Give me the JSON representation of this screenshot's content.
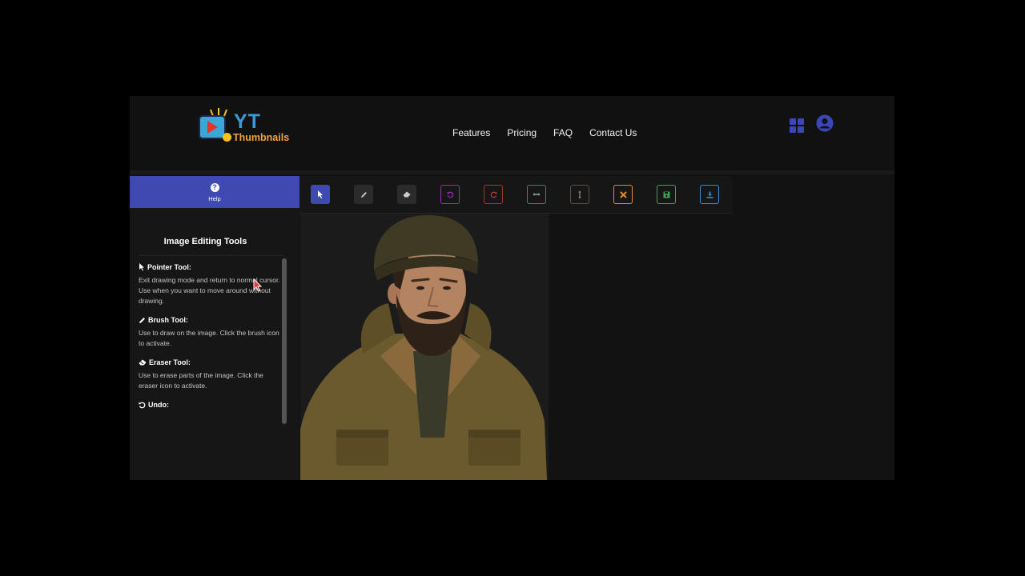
{
  "brand": {
    "logo_top": "YT",
    "logo_bottom": "Thumbnails"
  },
  "nav": [
    {
      "label": "Features"
    },
    {
      "label": "Pricing"
    },
    {
      "label": "FAQ"
    },
    {
      "label": "Contact Us"
    }
  ],
  "header_icons": [
    "grid-icon",
    "user-circle-icon"
  ],
  "help": {
    "icon": "question-circle-icon",
    "label": "Help"
  },
  "sidebar": {
    "title": "Image Editing Tools",
    "tools": [
      {
        "icon": "pointer-icon",
        "name": "Pointer Tool:",
        "description": "Exit drawing mode and return to normal cursor. Use when you want to move around without drawing."
      },
      {
        "icon": "pencil-icon",
        "name": "Brush Tool:",
        "description": "Use to draw on the image. Click the brush icon to activate."
      },
      {
        "icon": "eraser-icon",
        "name": "Eraser Tool:",
        "description": "Use to erase parts of the image. Click the eraser icon to activate."
      },
      {
        "icon": "undo-icon",
        "name": "Undo:",
        "description": ""
      }
    ]
  },
  "toolbar": {
    "buttons": [
      {
        "icon": "pointer-icon",
        "active": true,
        "color": "#3e49b2"
      },
      {
        "icon": "pencil-icon",
        "color": "#2b2b2b"
      },
      {
        "icon": "eraser-icon",
        "color": "#2b2b2b"
      },
      {
        "icon": "undo-icon",
        "color": "#9c2bb5"
      },
      {
        "icon": "redo-icon",
        "color": "#9a3a2e"
      },
      {
        "icon": "flip-horizontal-icon",
        "color": "#4b7d6f"
      },
      {
        "icon": "flip-vertical-icon",
        "color": "#5a5046"
      },
      {
        "icon": "clear-icon",
        "color": "#e68a2e"
      },
      {
        "icon": "save-icon",
        "color": "#3fa54b"
      },
      {
        "icon": "download-icon",
        "color": "#3a8ad6"
      }
    ]
  },
  "canvas": {
    "image_subject": "man in beanie and olive jacket",
    "colors": {
      "jacket": "#6b5a2e",
      "beanie": "#3f3a24",
      "skin": "#b48462",
      "beard": "#2e2218"
    }
  }
}
